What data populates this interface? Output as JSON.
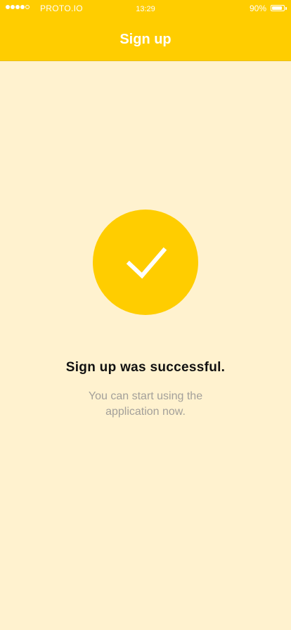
{
  "status_bar": {
    "carrier": "PROTO.IO",
    "time": "13:29",
    "battery": "90%",
    "battery_level": 0.9,
    "signal_bars_filled": 4,
    "signal_bars_total": 5
  },
  "header": {
    "title": "Sign up"
  },
  "success": {
    "icon": "checkmark-icon",
    "headline": "Sign up was successful.",
    "message": "You can start using the application now."
  },
  "colors": {
    "accent": "#FFCD00",
    "background": "#FFF2CF",
    "headline_text": "#111111",
    "message_text": "#A3A09A"
  }
}
